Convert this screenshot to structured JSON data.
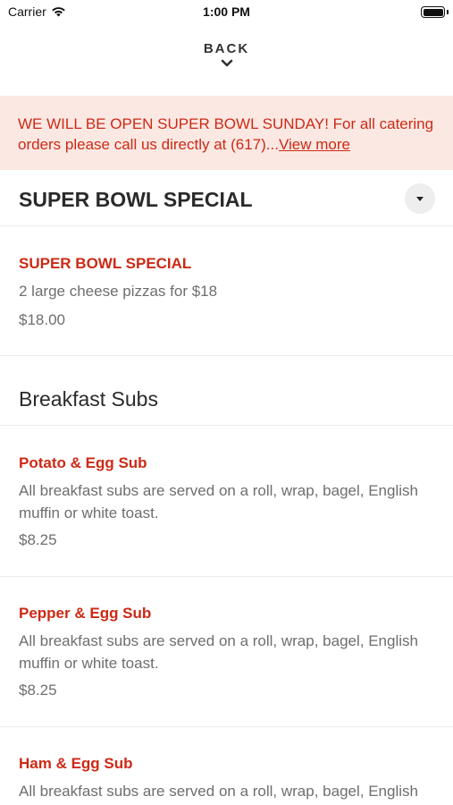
{
  "status_bar": {
    "carrier": "Carrier",
    "time": "1:00 PM",
    "wifi_icon": "wifi-icon",
    "battery_icon": "battery-icon"
  },
  "nav": {
    "back_label": "BACK",
    "chevron_icon": "chevron-down-icon"
  },
  "banner": {
    "text": "WE WILL BE OPEN SUPER BOWL SUNDAY! For all catering orders please call us directly at (617)...",
    "link_label": "View more",
    "background": "#fce8e3",
    "text_color": "#cc2a15"
  },
  "sections": [
    {
      "title": "SUPER BOWL SPECIAL",
      "dropdown_icon": "caret-down-icon",
      "items": [
        {
          "name": "SUPER BOWL SPECIAL",
          "description": "2 large cheese pizzas for $18",
          "price": "$18.00"
        }
      ]
    },
    {
      "title": "Breakfast Subs",
      "items": [
        {
          "name": "Potato & Egg Sub",
          "description": "All breakfast subs are served on a roll, wrap, bagel, English muffin or white toast.",
          "price": "$8.25"
        },
        {
          "name": "Pepper & Egg Sub",
          "description": "All breakfast subs are served on a roll, wrap, bagel, English muffin or white toast.",
          "price": "$8.25"
        },
        {
          "name": "Ham & Egg Sub",
          "description": "All breakfast subs are served on a roll, wrap, bagel, English"
        }
      ]
    }
  ],
  "colors": {
    "accent": "#cc2a15",
    "muted_text": "#6e6e6e"
  }
}
